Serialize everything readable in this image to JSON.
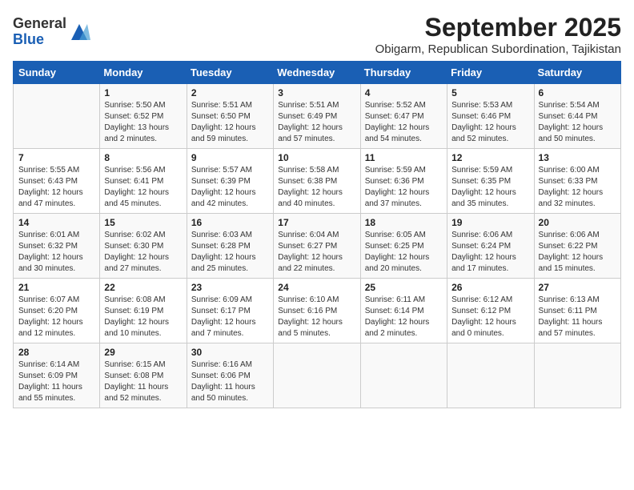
{
  "logo": {
    "general": "General",
    "blue": "Blue"
  },
  "title": "September 2025",
  "subtitle": "Obigarm, Republican Subordination, Tajikistan",
  "days_of_week": [
    "Sunday",
    "Monday",
    "Tuesday",
    "Wednesday",
    "Thursday",
    "Friday",
    "Saturday"
  ],
  "weeks": [
    [
      {
        "day": "",
        "info": ""
      },
      {
        "day": "1",
        "info": "Sunrise: 5:50 AM\nSunset: 6:52 PM\nDaylight: 13 hours\nand 2 minutes."
      },
      {
        "day": "2",
        "info": "Sunrise: 5:51 AM\nSunset: 6:50 PM\nDaylight: 12 hours\nand 59 minutes."
      },
      {
        "day": "3",
        "info": "Sunrise: 5:51 AM\nSunset: 6:49 PM\nDaylight: 12 hours\nand 57 minutes."
      },
      {
        "day": "4",
        "info": "Sunrise: 5:52 AM\nSunset: 6:47 PM\nDaylight: 12 hours\nand 54 minutes."
      },
      {
        "day": "5",
        "info": "Sunrise: 5:53 AM\nSunset: 6:46 PM\nDaylight: 12 hours\nand 52 minutes."
      },
      {
        "day": "6",
        "info": "Sunrise: 5:54 AM\nSunset: 6:44 PM\nDaylight: 12 hours\nand 50 minutes."
      }
    ],
    [
      {
        "day": "7",
        "info": "Sunrise: 5:55 AM\nSunset: 6:43 PM\nDaylight: 12 hours\nand 47 minutes."
      },
      {
        "day": "8",
        "info": "Sunrise: 5:56 AM\nSunset: 6:41 PM\nDaylight: 12 hours\nand 45 minutes."
      },
      {
        "day": "9",
        "info": "Sunrise: 5:57 AM\nSunset: 6:39 PM\nDaylight: 12 hours\nand 42 minutes."
      },
      {
        "day": "10",
        "info": "Sunrise: 5:58 AM\nSunset: 6:38 PM\nDaylight: 12 hours\nand 40 minutes."
      },
      {
        "day": "11",
        "info": "Sunrise: 5:59 AM\nSunset: 6:36 PM\nDaylight: 12 hours\nand 37 minutes."
      },
      {
        "day": "12",
        "info": "Sunrise: 5:59 AM\nSunset: 6:35 PM\nDaylight: 12 hours\nand 35 minutes."
      },
      {
        "day": "13",
        "info": "Sunrise: 6:00 AM\nSunset: 6:33 PM\nDaylight: 12 hours\nand 32 minutes."
      }
    ],
    [
      {
        "day": "14",
        "info": "Sunrise: 6:01 AM\nSunset: 6:32 PM\nDaylight: 12 hours\nand 30 minutes."
      },
      {
        "day": "15",
        "info": "Sunrise: 6:02 AM\nSunset: 6:30 PM\nDaylight: 12 hours\nand 27 minutes."
      },
      {
        "day": "16",
        "info": "Sunrise: 6:03 AM\nSunset: 6:28 PM\nDaylight: 12 hours\nand 25 minutes."
      },
      {
        "day": "17",
        "info": "Sunrise: 6:04 AM\nSunset: 6:27 PM\nDaylight: 12 hours\nand 22 minutes."
      },
      {
        "day": "18",
        "info": "Sunrise: 6:05 AM\nSunset: 6:25 PM\nDaylight: 12 hours\nand 20 minutes."
      },
      {
        "day": "19",
        "info": "Sunrise: 6:06 AM\nSunset: 6:24 PM\nDaylight: 12 hours\nand 17 minutes."
      },
      {
        "day": "20",
        "info": "Sunrise: 6:06 AM\nSunset: 6:22 PM\nDaylight: 12 hours\nand 15 minutes."
      }
    ],
    [
      {
        "day": "21",
        "info": "Sunrise: 6:07 AM\nSunset: 6:20 PM\nDaylight: 12 hours\nand 12 minutes."
      },
      {
        "day": "22",
        "info": "Sunrise: 6:08 AM\nSunset: 6:19 PM\nDaylight: 12 hours\nand 10 minutes."
      },
      {
        "day": "23",
        "info": "Sunrise: 6:09 AM\nSunset: 6:17 PM\nDaylight: 12 hours\nand 7 minutes."
      },
      {
        "day": "24",
        "info": "Sunrise: 6:10 AM\nSunset: 6:16 PM\nDaylight: 12 hours\nand 5 minutes."
      },
      {
        "day": "25",
        "info": "Sunrise: 6:11 AM\nSunset: 6:14 PM\nDaylight: 12 hours\nand 2 minutes."
      },
      {
        "day": "26",
        "info": "Sunrise: 6:12 AM\nSunset: 6:12 PM\nDaylight: 12 hours\nand 0 minutes."
      },
      {
        "day": "27",
        "info": "Sunrise: 6:13 AM\nSunset: 6:11 PM\nDaylight: 11 hours\nand 57 minutes."
      }
    ],
    [
      {
        "day": "28",
        "info": "Sunrise: 6:14 AM\nSunset: 6:09 PM\nDaylight: 11 hours\nand 55 minutes."
      },
      {
        "day": "29",
        "info": "Sunrise: 6:15 AM\nSunset: 6:08 PM\nDaylight: 11 hours\nand 52 minutes."
      },
      {
        "day": "30",
        "info": "Sunrise: 6:16 AM\nSunset: 6:06 PM\nDaylight: 11 hours\nand 50 minutes."
      },
      {
        "day": "",
        "info": ""
      },
      {
        "day": "",
        "info": ""
      },
      {
        "day": "",
        "info": ""
      },
      {
        "day": "",
        "info": ""
      }
    ]
  ]
}
